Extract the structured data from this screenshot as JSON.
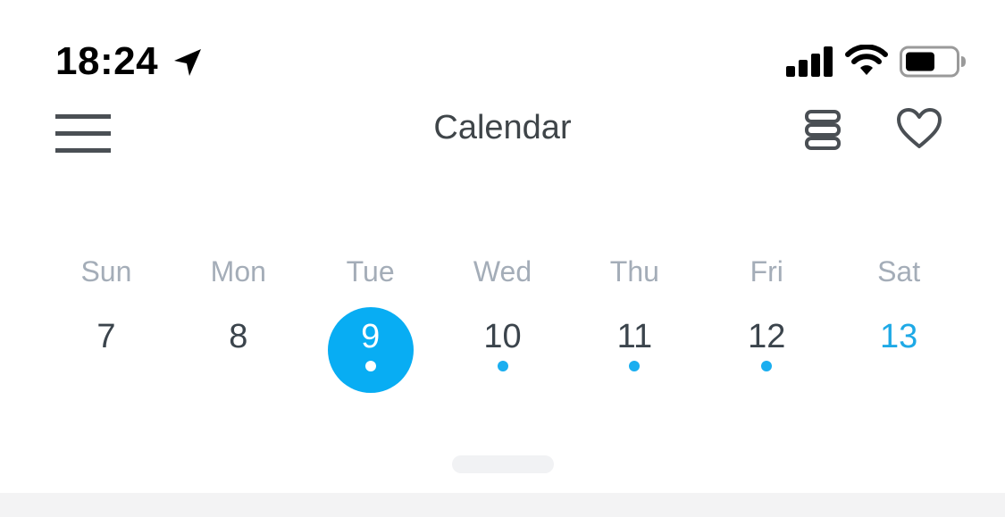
{
  "status_bar": {
    "time": "18:24",
    "icons": [
      "location-arrow-icon",
      "cellular-signal-icon",
      "wifi-icon",
      "battery-icon"
    ]
  },
  "header": {
    "title": "Calendar",
    "left_icon": "hamburger-menu-icon",
    "right_icons": [
      "list-stack-icon",
      "heart-icon"
    ]
  },
  "week": {
    "days": [
      {
        "dow": "Sun",
        "date": "7",
        "has_event": false,
        "selected": false,
        "weekend": false
      },
      {
        "dow": "Mon",
        "date": "8",
        "has_event": false,
        "selected": false,
        "weekend": false
      },
      {
        "dow": "Tue",
        "date": "9",
        "has_event": true,
        "selected": true,
        "weekend": false
      },
      {
        "dow": "Wed",
        "date": "10",
        "has_event": true,
        "selected": false,
        "weekend": false
      },
      {
        "dow": "Thu",
        "date": "11",
        "has_event": true,
        "selected": false,
        "weekend": false
      },
      {
        "dow": "Fri",
        "date": "12",
        "has_event": true,
        "selected": false,
        "weekend": false
      },
      {
        "dow": "Sat",
        "date": "13",
        "has_event": false,
        "selected": false,
        "weekend": true
      }
    ]
  },
  "colors": {
    "accent": "#08adf3",
    "event_dot": "#1aaef0",
    "weekday_label": "#a4adb8",
    "title_text": "#3f4549"
  }
}
